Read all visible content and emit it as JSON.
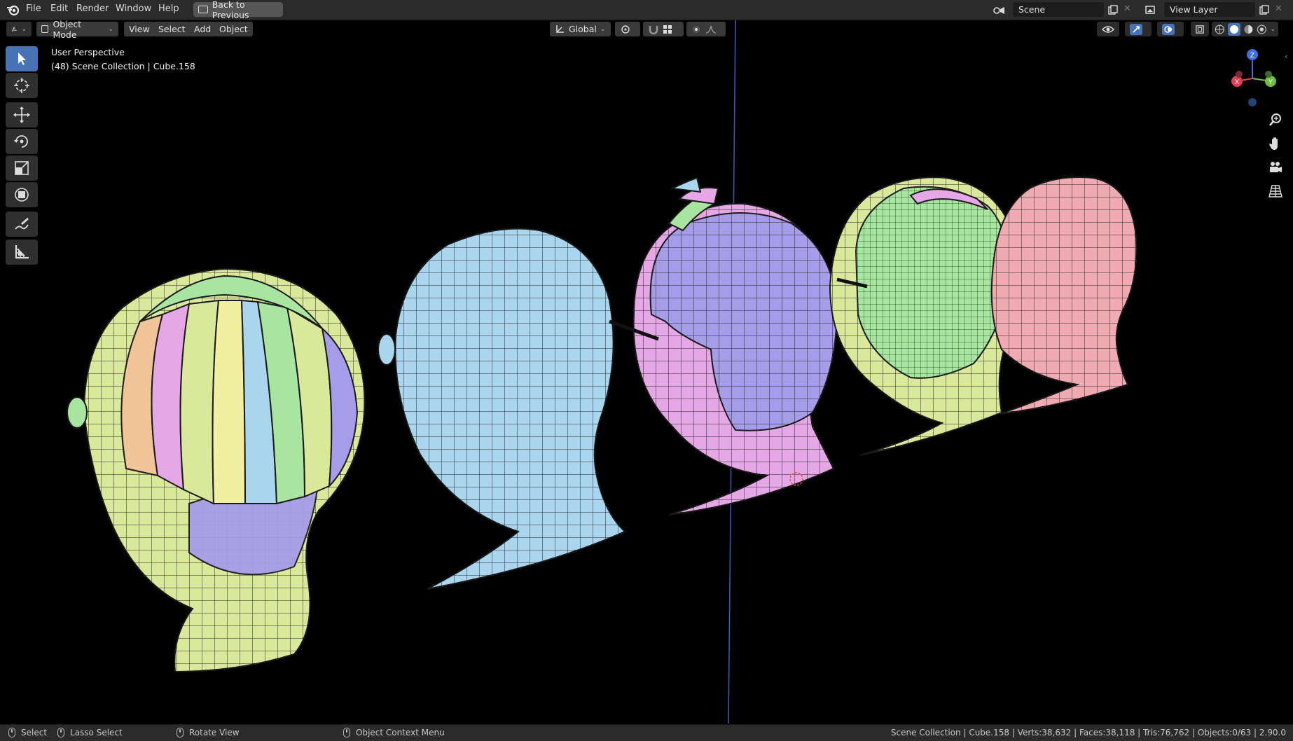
{
  "menubar": {
    "items": [
      "File",
      "Edit",
      "Render",
      "Window",
      "Help"
    ],
    "back_button": "Back to Previous",
    "scene_field": "Scene",
    "view_layer_field": "View Layer"
  },
  "header": {
    "mode": "Object Mode",
    "menus": [
      "View",
      "Select",
      "Add",
      "Object"
    ],
    "transform_orientation": "Global"
  },
  "viewport": {
    "perspective_label": "User Perspective",
    "collection_label": "(48) Scene Collection | Cube.158",
    "gizmo_axes": [
      "Z",
      "X",
      "Y"
    ],
    "mesh_colors": {
      "yellow": "#d9e89a",
      "blue": "#a9d5ee",
      "pink": "#e6a7e6",
      "purple": "#a79ce8",
      "green": "#a7e5a0",
      "salmon": "#f0aab2",
      "orange": "#f2c49a"
    }
  },
  "toolbar": {
    "tools": [
      "select-box",
      "cursor",
      "move",
      "rotate",
      "scale",
      "transform",
      "annotate",
      "measure"
    ]
  },
  "statusbar": {
    "select": "Select",
    "lasso": "Lasso Select",
    "rotate": "Rotate View",
    "context_menu": "Object Context Menu",
    "stats": "Scene Collection | Cube.158 | Verts:38,632 | Faces:38,118 | Tris:76,762 | Objects:0/63 | 2.90.0"
  },
  "theme": {
    "accent": "#4772b3",
    "panel_bg": "#2b2b2b",
    "viewport_bg": "#000000"
  }
}
